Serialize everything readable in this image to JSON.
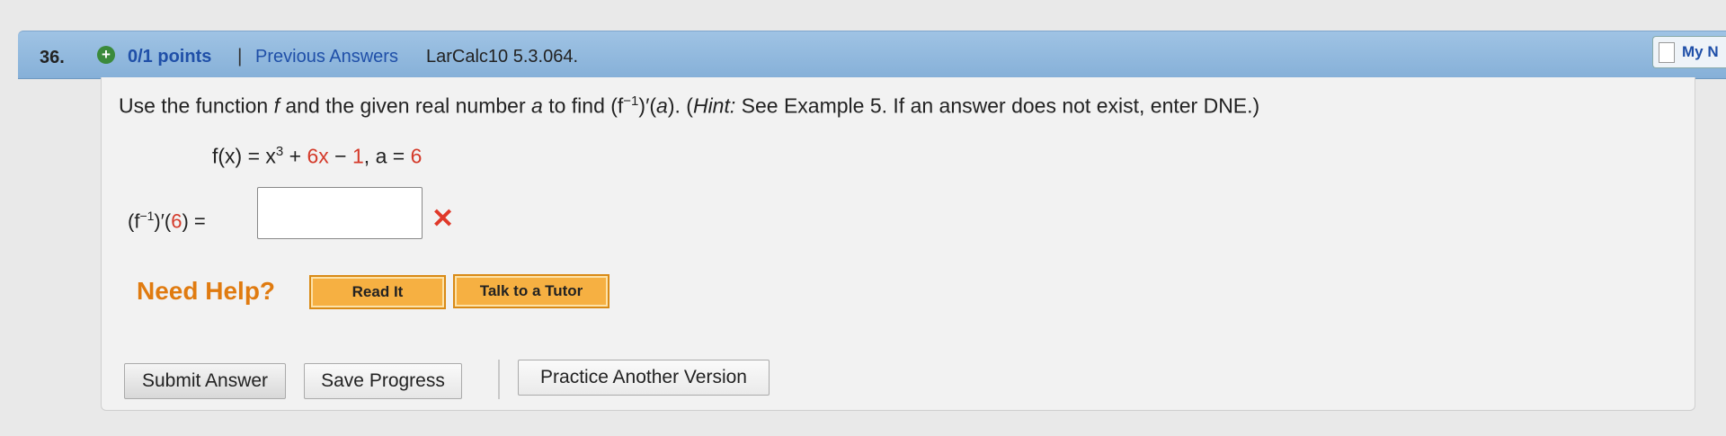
{
  "header": {
    "question_number": "36.",
    "points": "0/1 points",
    "separator": "|",
    "previous_answers": "Previous Answers",
    "reference": "LarCalc10 5.3.064.",
    "notes_label": "My N"
  },
  "question": {
    "t1": "Use the function ",
    "f": "f",
    "t2": " and the given real number ",
    "a": "a",
    "t3": " to find  (f",
    "exp": "−1",
    "t4": ")′(",
    "a2": "a",
    "t5": ").  (",
    "hint_label": "Hint:",
    "hint_text": " See Example 5. If an answer does not exist, enter DNE.)"
  },
  "formula": {
    "lhs": "f(x) = x",
    "pow": "3",
    "plus": " + ",
    "coef": "6x",
    "minus": " − ",
    "const": "1",
    "comma": ",      a = ",
    "a_value": "6"
  },
  "answer": {
    "label_pre": "(f",
    "label_exp": "−1",
    "label_mid": ")′(",
    "label_arg": "6",
    "label_post": ") =",
    "value": "",
    "status_icon": "incorrect-x"
  },
  "help": {
    "need_help": "Need Help?",
    "read_it": "Read It",
    "tutor": "Talk to a Tutor"
  },
  "actions": {
    "submit": "Submit Answer",
    "save": "Save Progress",
    "practice": "Practice Another Version"
  }
}
